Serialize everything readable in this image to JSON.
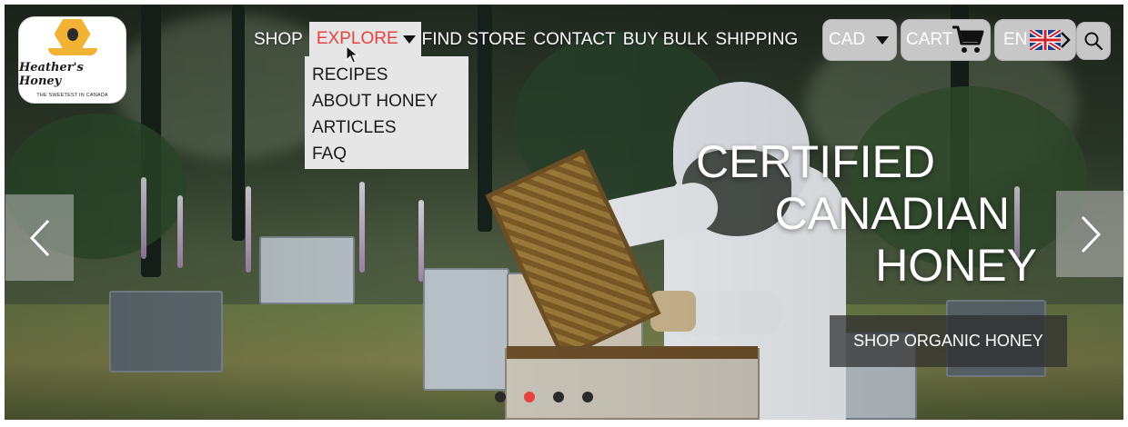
{
  "brand": {
    "name": "Heather's Honey",
    "tagline": "THE SWEETEST IN CANADA"
  },
  "nav": {
    "items": [
      {
        "label": "SHOP"
      },
      {
        "label": "EXPLORE",
        "active": true
      },
      {
        "label": "FIND STORE"
      },
      {
        "label": "CONTACT"
      },
      {
        "label": "BUY BULK"
      },
      {
        "label": "SHIPPING"
      }
    ],
    "explore_menu": [
      "RECIPES",
      "ABOUT HONEY",
      "ARTICLES",
      "FAQ"
    ]
  },
  "header": {
    "currency": "CAD",
    "cart_label": "CART",
    "language": "EN"
  },
  "hero": {
    "headline": [
      "CERTIFIED",
      "CANADIAN",
      "HONEY"
    ],
    "cta_label": "SHOP ORGANIC HONEY",
    "slide_count": 4,
    "active_slide": 2
  },
  "icons": {
    "prev": "chevron-left-icon",
    "next": "chevron-right-icon",
    "cart": "cart-icon",
    "search": "search-icon",
    "flag": "uk-flag-icon"
  },
  "colors": {
    "accent": "#e8423e",
    "pill_bg": "#c7c7c7",
    "menu_bg": "#e6e6e6"
  }
}
